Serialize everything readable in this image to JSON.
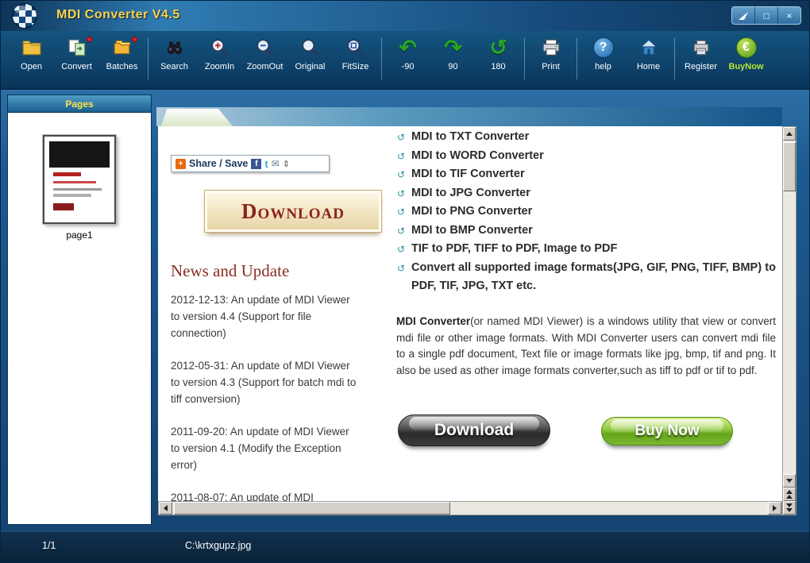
{
  "window": {
    "title": "MDI Converter V4.5",
    "maximize_glyph": "□",
    "close_glyph": "×"
  },
  "toolbar": {
    "items": [
      {
        "label": "Open",
        "icon": "open-folder"
      },
      {
        "label": "Convert",
        "icon": "convert-pages"
      },
      {
        "label": "Batches",
        "icon": "batch-folders"
      },
      {
        "label": "Search",
        "icon": "binoculars"
      },
      {
        "label": "ZoomIn",
        "icon": "magnifier-plus"
      },
      {
        "label": "ZoomOut",
        "icon": "magnifier-minus"
      },
      {
        "label": "Original",
        "icon": "magnifier"
      },
      {
        "label": "FitSize",
        "icon": "magnifier-fit"
      },
      {
        "label": "-90",
        "icon": "rotate-left-arrow",
        "glyph": "↶"
      },
      {
        "label": "90",
        "icon": "rotate-right-arrow",
        "glyph": "↷"
      },
      {
        "label": "180",
        "icon": "rotate-180-arrow",
        "glyph": "↺"
      },
      {
        "label": "Print",
        "icon": "printer"
      },
      {
        "label": "help",
        "icon": "question-circle",
        "glyph": "?"
      },
      {
        "label": "Home",
        "icon": "house"
      },
      {
        "label": "Register",
        "icon": "register-device"
      },
      {
        "label": "BuyNow",
        "icon": "euro-circle",
        "glyph": "€"
      }
    ]
  },
  "sidebar": {
    "header": "Pages",
    "page_label": "page1"
  },
  "page": {
    "share_save": {
      "label": "Share / Save",
      "addthis_glyph": "+",
      "facebook_glyph": "f",
      "twitter_glyph": "t",
      "mail_glyph": "✉",
      "expand_glyph": "⇕"
    },
    "download_box_label": "Download",
    "news": {
      "heading": "News and Update",
      "items": [
        "2012-12-13: An update of MDI Viewer to version 4.4 (Support for file connection)",
        "2012-05-31: An update of MDI Viewer to version 4.3 (Support for batch mdi to tiff conversion)",
        "2011-09-20: An update of MDI Viewer to version 4.1 (Modify the Exception error)",
        "2011-08-07: An update of MDI"
      ]
    },
    "features": [
      "MDI to TXT Converter",
      "MDI to WORD Converter",
      "MDI to TIF Converter",
      "MDI to JPG Converter",
      "MDI to PNG Converter",
      "MDI to BMP Converter",
      "TIF to PDF, TIFF to PDF, Image to PDF",
      "Convert all supported image formats(JPG, GIF, PNG, TIFF, BMP) to PDF, TIF, JPG, TXT etc."
    ],
    "about": {
      "lead": "MDI Converter",
      "text": "(or named MDI Viewer) is a windows utility that view or convert mdi file or other image formats. With MDI Converter users can convert mdi file to a single pdf document, Text file or image formats like jpg, bmp, tif and png. It also be used as other image formats converter,such as tiff to pdf or tif to pdf."
    },
    "download_button": "Download",
    "buynow_button": "Buy Now"
  },
  "statusbar": {
    "page_indicator": "1/1",
    "file_path": "C:\\krtxgupz.jpg"
  },
  "colors": {
    "title_gold": "#ffd24a",
    "toolbar_blue": "#0d3f68",
    "buynow_green": "#7ab82e",
    "heading_maroon": "#8a2f23"
  }
}
